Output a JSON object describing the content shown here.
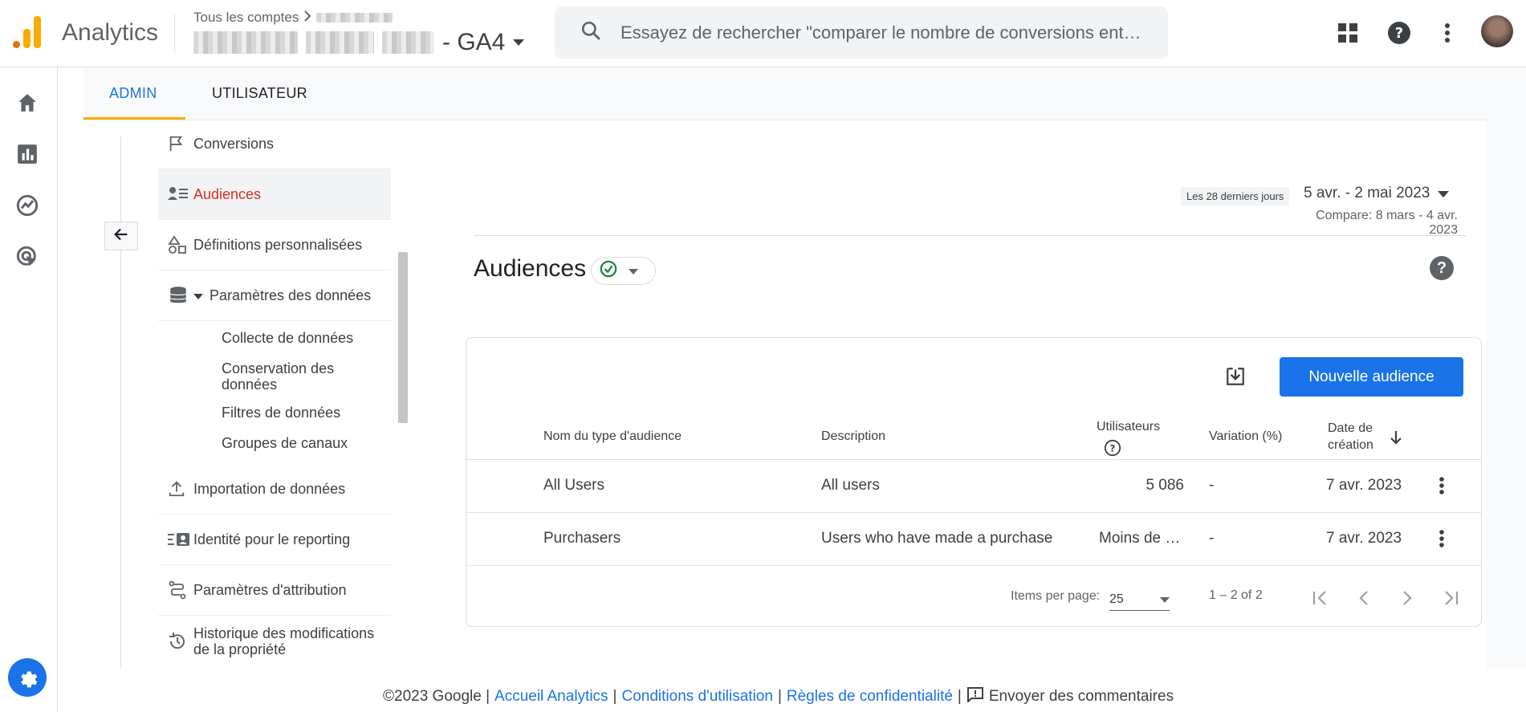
{
  "header": {
    "app_name": "Analytics",
    "breadcrumb": "Tous les comptes",
    "property_suffix": "- GA4",
    "search_placeholder": "Essayez de rechercher \"comparer le nombre de conversions ent…"
  },
  "tabs": [
    {
      "label": "ADMIN",
      "active": true
    },
    {
      "label": "UTILISATEUR",
      "active": false
    }
  ],
  "nav": {
    "items": [
      {
        "label": "Conversions",
        "icon": "flag-icon"
      },
      {
        "label": "Audiences",
        "icon": "audience-list-icon",
        "active": true
      },
      {
        "label": "Définitions personnalisées",
        "icon": "shapes-icon"
      },
      {
        "label": "Paramètres des données",
        "icon": "database-icon"
      },
      {
        "label": "Importation de données",
        "icon": "upload-icon"
      },
      {
        "label": "Identité pour le reporting",
        "icon": "identity-icon"
      },
      {
        "label": "Paramètres d'attribution",
        "icon": "route-icon"
      },
      {
        "label": "Historique des modifications de la propriété",
        "icon": "history-icon"
      }
    ],
    "sub_items": [
      {
        "label": "Collecte de données"
      },
      {
        "label": "Conservation des données"
      },
      {
        "label": "Filtres de données"
      },
      {
        "label": "Groupes de canaux"
      }
    ]
  },
  "date": {
    "chip": "Les 28 derniers jours",
    "range": "5 avr. - 2 mai 2023",
    "compare": "Compare: 8 mars - 4 avr. 2023"
  },
  "page": {
    "title": "Audiences",
    "new_button": "Nouvelle audience"
  },
  "table": {
    "columns": [
      "Nom du type d'audience",
      "Description",
      "Utilisateurs",
      "Variation (%)",
      "Date de création"
    ],
    "rows": [
      {
        "name": "All Users",
        "description": "All users",
        "users": "5 086",
        "variation": "-",
        "date": "7 avr. 2023"
      },
      {
        "name": "Purchasers",
        "description": "Users who have made a purchase",
        "users": "Moins de …",
        "variation": "-",
        "date": "7 avr. 2023"
      }
    ]
  },
  "pagination": {
    "items_per_page_label": "Items per page:",
    "items_per_page": "25",
    "range": "1 – 2 of 2"
  },
  "footer": {
    "copyright": "©2023 Google |",
    "link_home": "Accueil Analytics",
    "link_terms": "Conditions d'utilisation",
    "link_privacy": "Règles de confidentialité",
    "sep": "|",
    "feedback": "Envoyer des commentaires"
  },
  "colors": {
    "accent": "#1a73e8",
    "active_nav": "#d93025",
    "tab_indicator": "#f9ab00"
  }
}
